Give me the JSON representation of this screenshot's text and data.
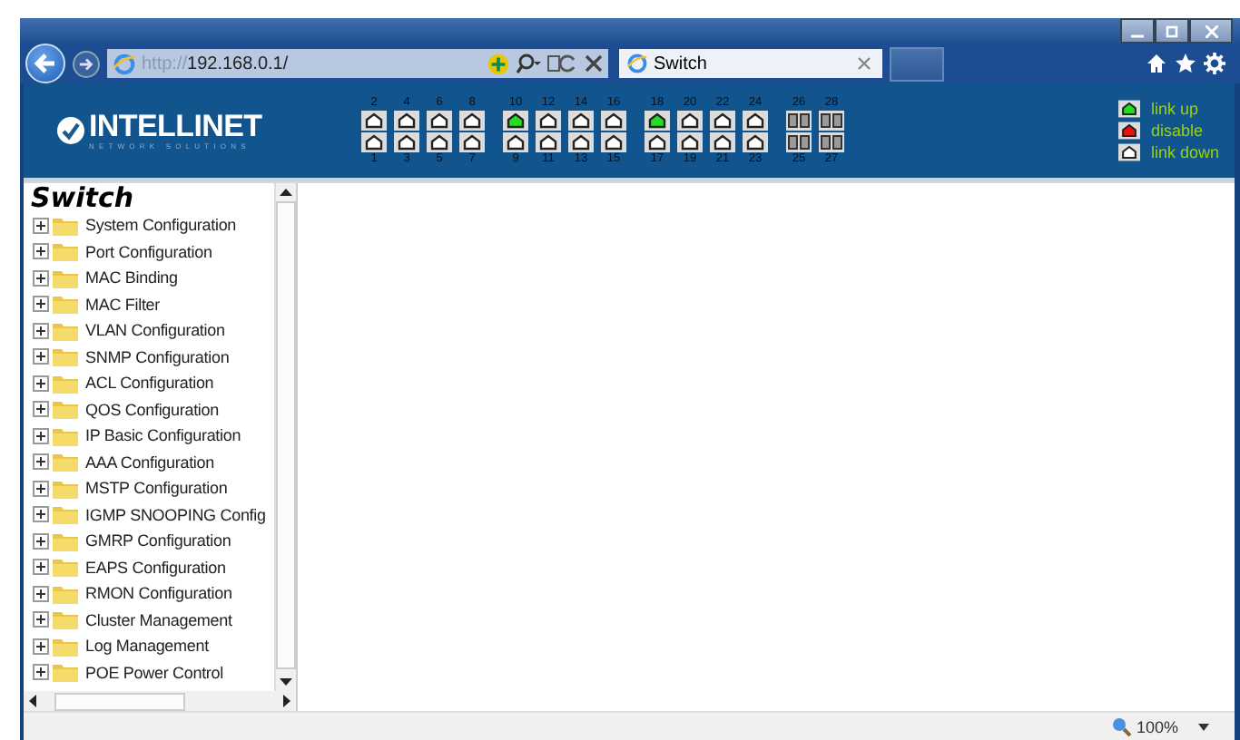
{
  "browser": {
    "url_scheme": "http://",
    "url_host": "192.168.0.1/",
    "tab_title": "Switch",
    "zoom": "100%"
  },
  "header": {
    "logo": "INTELLINET",
    "tagline": "NETWORK SOLUTIONS",
    "port_groups": [
      {
        "top": [
          {
            "label": "2",
            "link_up": false,
            "kind": "copper"
          },
          {
            "label": "4",
            "link_up": false,
            "kind": "copper"
          },
          {
            "label": "6",
            "link_up": false,
            "kind": "copper"
          },
          {
            "label": "8",
            "link_up": false,
            "kind": "copper"
          }
        ],
        "bottom": [
          {
            "label": "1",
            "link_up": false,
            "kind": "copper"
          },
          {
            "label": "3",
            "link_up": false,
            "kind": "copper"
          },
          {
            "label": "5",
            "link_up": false,
            "kind": "copper"
          },
          {
            "label": "7",
            "link_up": false,
            "kind": "copper"
          }
        ]
      },
      {
        "top": [
          {
            "label": "10",
            "link_up": true,
            "kind": "copper"
          },
          {
            "label": "12",
            "link_up": false,
            "kind": "copper"
          },
          {
            "label": "14",
            "link_up": false,
            "kind": "copper"
          },
          {
            "label": "16",
            "link_up": false,
            "kind": "copper"
          }
        ],
        "bottom": [
          {
            "label": "9",
            "link_up": false,
            "kind": "copper"
          },
          {
            "label": "11",
            "link_up": false,
            "kind": "copper"
          },
          {
            "label": "13",
            "link_up": false,
            "kind": "copper"
          },
          {
            "label": "15",
            "link_up": false,
            "kind": "copper"
          }
        ]
      },
      {
        "top": [
          {
            "label": "18",
            "link_up": true,
            "kind": "copper"
          },
          {
            "label": "20",
            "link_up": false,
            "kind": "copper"
          },
          {
            "label": "22",
            "link_up": false,
            "kind": "copper"
          },
          {
            "label": "24",
            "link_up": false,
            "kind": "copper"
          }
        ],
        "bottom": [
          {
            "label": "17",
            "link_up": false,
            "kind": "copper"
          },
          {
            "label": "19",
            "link_up": false,
            "kind": "copper"
          },
          {
            "label": "21",
            "link_up": false,
            "kind": "copper"
          },
          {
            "label": "23",
            "link_up": false,
            "kind": "copper"
          }
        ]
      },
      {
        "top": [
          {
            "label": "26",
            "link_up": false,
            "kind": "fiber"
          },
          {
            "label": "28",
            "link_up": false,
            "kind": "fiber"
          }
        ],
        "bottom": [
          {
            "label": "25",
            "link_up": false,
            "kind": "fiber"
          },
          {
            "label": "27",
            "link_up": false,
            "kind": "fiber"
          }
        ]
      }
    ],
    "legend": [
      {
        "kind": "up",
        "label": "link up"
      },
      {
        "kind": "disabled",
        "label": "disable"
      },
      {
        "kind": "down",
        "label": "link down"
      }
    ]
  },
  "tree": {
    "title": "Switch",
    "items": [
      {
        "label": "System Configuration",
        "expanded": false
      },
      {
        "label": "Port Configuration",
        "expanded": false
      },
      {
        "label": "MAC Binding",
        "expanded": false
      },
      {
        "label": "MAC Filter",
        "expanded": false
      },
      {
        "label": "VLAN Configuration",
        "expanded": false
      },
      {
        "label": "SNMP Configuration",
        "expanded": false
      },
      {
        "label": "ACL Configuration",
        "expanded": false
      },
      {
        "label": "QOS Configuration",
        "expanded": false
      },
      {
        "label": "IP Basic Configuration",
        "expanded": false
      },
      {
        "label": "AAA Configuration",
        "expanded": false
      },
      {
        "label": "MSTP Configuration",
        "expanded": false
      },
      {
        "label": "IGMP SNOOPING Config",
        "expanded": false
      },
      {
        "label": "GMRP Configuration",
        "expanded": false
      },
      {
        "label": "EAPS Configuration",
        "expanded": false
      },
      {
        "label": "RMON Configuration",
        "expanded": false
      },
      {
        "label": "Cluster Management",
        "expanded": false
      },
      {
        "label": "Log Management",
        "expanded": false
      },
      {
        "label": "POE Power Control",
        "expanded": false
      }
    ]
  }
}
